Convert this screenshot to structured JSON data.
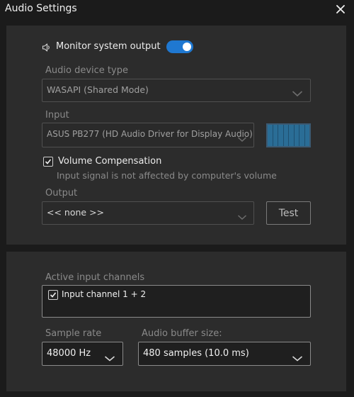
{
  "window": {
    "title": "Audio Settings"
  },
  "monitor": {
    "label": "Monitor system output",
    "enabled": true
  },
  "device_type": {
    "label": "Audio device type",
    "value": "WASAPI (Shared Mode)"
  },
  "input": {
    "label": "Input",
    "value": "ASUS PB277 (HD Audio Driver for Display Audio)",
    "meter_segments": 8
  },
  "volume_compensation": {
    "label": "Volume Compensation",
    "checked": true,
    "hint": "Input signal is not affected by computer's volume"
  },
  "output": {
    "label": "Output",
    "value": "<< none >>",
    "test_label": "Test"
  },
  "channels": {
    "label": "Active input channels",
    "items": [
      {
        "label": "Input channel 1 + 2",
        "checked": true
      }
    ]
  },
  "sample_rate": {
    "label": "Sample rate",
    "value": "48000 Hz"
  },
  "buffer": {
    "label": "Audio buffer size:",
    "value": "480 samples (10.0 ms)"
  },
  "colors": {
    "accent": "#1f78d1",
    "meter": "#2a6d96"
  }
}
